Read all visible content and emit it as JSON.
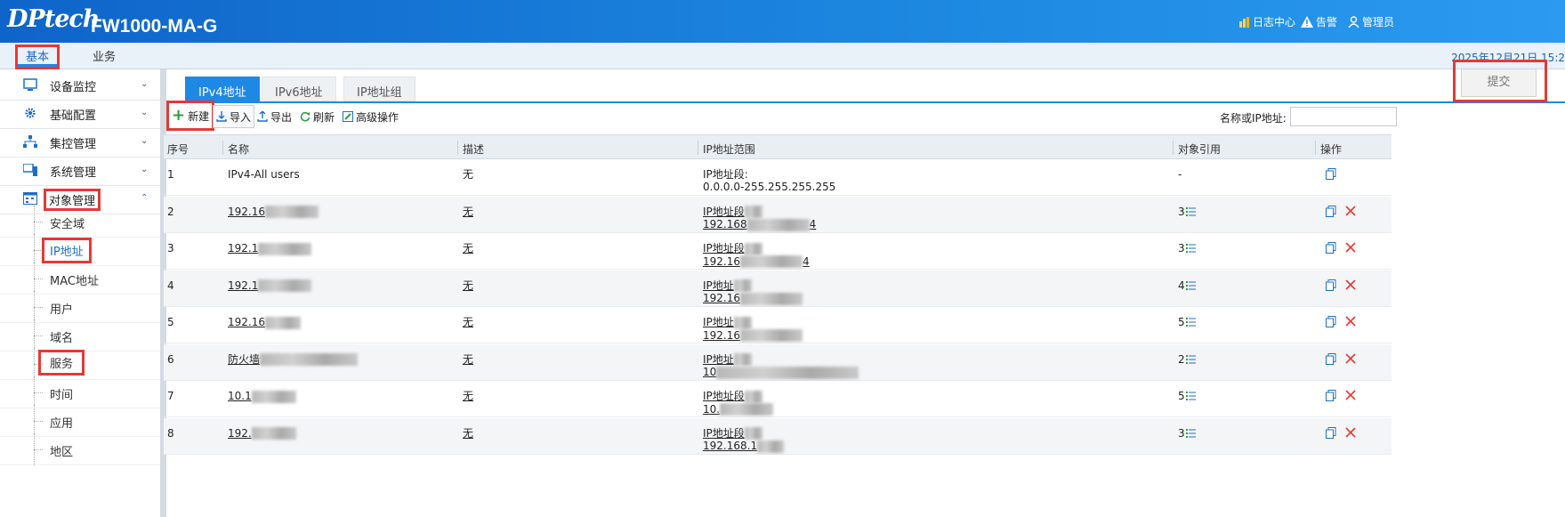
{
  "header": {
    "logo": "DPtech",
    "product": "FW1000-MA-G",
    "links": [
      {
        "label": "日志中心",
        "icon": "bar-chart-icon"
      },
      {
        "label": "告警",
        "icon": "warning-icon"
      },
      {
        "label": "管理员",
        "icon": "user-icon"
      }
    ]
  },
  "menubar": {
    "tabs": [
      {
        "label": "基本"
      },
      {
        "label": "业务"
      }
    ],
    "datetime": "2025年12月21日 15:2"
  },
  "sidebar": {
    "groups": [
      {
        "label": "设备监控",
        "icon": "monitor-icon"
      },
      {
        "label": "基础配置",
        "icon": "gear-icon"
      },
      {
        "label": "集控管理",
        "icon": "network-icon"
      },
      {
        "label": "系统管理",
        "icon": "system-icon"
      },
      {
        "label": "对象管理",
        "icon": "object-icon"
      }
    ],
    "items": [
      {
        "label": "安全域"
      },
      {
        "label": "IP地址"
      },
      {
        "label": "MAC地址"
      },
      {
        "label": "用户"
      },
      {
        "label": "域名"
      },
      {
        "label": "服务"
      },
      {
        "label": "时间"
      },
      {
        "label": "应用"
      },
      {
        "label": "地区"
      }
    ]
  },
  "content": {
    "tabs": [
      {
        "label": "IPv4地址"
      },
      {
        "label": "IPv6地址"
      },
      {
        "label": "IP地址组"
      }
    ],
    "submit": "提交",
    "toolbar": {
      "new": "新建",
      "import": "导入",
      "export": "导出",
      "refresh": "刷新",
      "advanced": "高级操作",
      "search_label": "名称或IP地址:",
      "search_value": ""
    },
    "columns": {
      "index": "序号",
      "name": "名称",
      "desc": "描述",
      "range": "IP地址范围",
      "ref": "对象引用",
      "op": "操作"
    },
    "rows": [
      {
        "index": "1",
        "name": "IPv4-All users",
        "desc": "无",
        "range1": "IP地址段:",
        "range2": "0.0.0.0-255.255.255.255",
        "ref": "-"
      },
      {
        "index": "2",
        "name": "192.16",
        "desc": "无",
        "range1": "IP地址段",
        "range2": "192.168",
        "range2b": "4",
        "ref": "3"
      },
      {
        "index": "3",
        "name": "192.1",
        "desc": "无",
        "range1": "IP地址段",
        "range2": "192.16",
        "range2b": "4",
        "ref": "3"
      },
      {
        "index": "4",
        "name": "192.1",
        "desc": "无",
        "range1": "IP地址",
        "range2": "192.16",
        "range2b": "",
        "ref": "4"
      },
      {
        "index": "5",
        "name": "192.16",
        "desc": "无",
        "range1": "IP地址",
        "range2": "192.16",
        "range2b": "",
        "ref": "5"
      },
      {
        "index": "6",
        "name": "防火墙",
        "desc": "无",
        "range1": "IP地址",
        "range2": "10",
        "range2b": "",
        "ref": "2"
      },
      {
        "index": "7",
        "name": "10.1",
        "desc": "无",
        "range1": "IP地址段",
        "range2": "10.",
        "range2b": "",
        "ref": "5"
      },
      {
        "index": "8",
        "name": "192.",
        "desc": "无",
        "range1": "IP地址段",
        "range2": "192.168.1",
        "range2b": "",
        "ref": "3"
      }
    ]
  },
  "colors": {
    "accent": "#1e88e5",
    "highlight": "#e53935",
    "delete": "#e53935"
  }
}
